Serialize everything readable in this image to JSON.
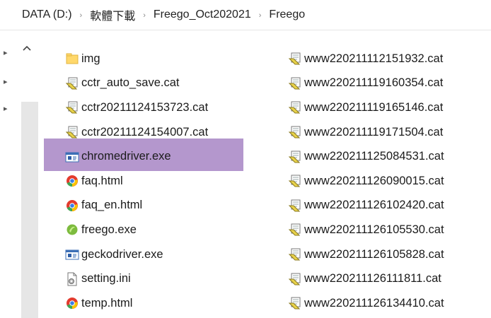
{
  "breadcrumb": {
    "items": [
      "DATA (D:)",
      "軟體下載",
      "Freego_Oct202021",
      "Freego"
    ]
  },
  "files_left": [
    {
      "name": "img",
      "type": "folder"
    },
    {
      "name": "cctr_auto_save.cat",
      "type": "cat"
    },
    {
      "name": "cctr20211124153723.cat",
      "type": "cat"
    },
    {
      "name": "cctr20211124154007.cat",
      "type": "cat"
    },
    {
      "name": "chromedriver.exe",
      "type": "exe-window",
      "selected": true
    },
    {
      "name": "faq.html",
      "type": "chrome-html"
    },
    {
      "name": "faq_en.html",
      "type": "chrome-html"
    },
    {
      "name": "freego.exe",
      "type": "freego-exe"
    },
    {
      "name": "geckodriver.exe",
      "type": "exe-window"
    },
    {
      "name": "setting.ini",
      "type": "ini"
    },
    {
      "name": "temp.html",
      "type": "chrome-html"
    }
  ],
  "files_right": [
    {
      "name": "www220211112151932.cat",
      "type": "cat"
    },
    {
      "name": "www220211119160354.cat",
      "type": "cat"
    },
    {
      "name": "www220211119165146.cat",
      "type": "cat"
    },
    {
      "name": "www220211119171504.cat",
      "type": "cat"
    },
    {
      "name": "www220211125084531.cat",
      "type": "cat"
    },
    {
      "name": "www220211126090015.cat",
      "type": "cat"
    },
    {
      "name": "www220211126102420.cat",
      "type": "cat"
    },
    {
      "name": "www220211126105530.cat",
      "type": "cat"
    },
    {
      "name": "www220211126105828.cat",
      "type": "cat"
    },
    {
      "name": "www220211126111811.cat",
      "type": "cat"
    },
    {
      "name": "www220211126134410.cat",
      "type": "cat"
    }
  ],
  "colors": {
    "selection": "#b497cd",
    "scroll_track": "#e6e6e6"
  }
}
